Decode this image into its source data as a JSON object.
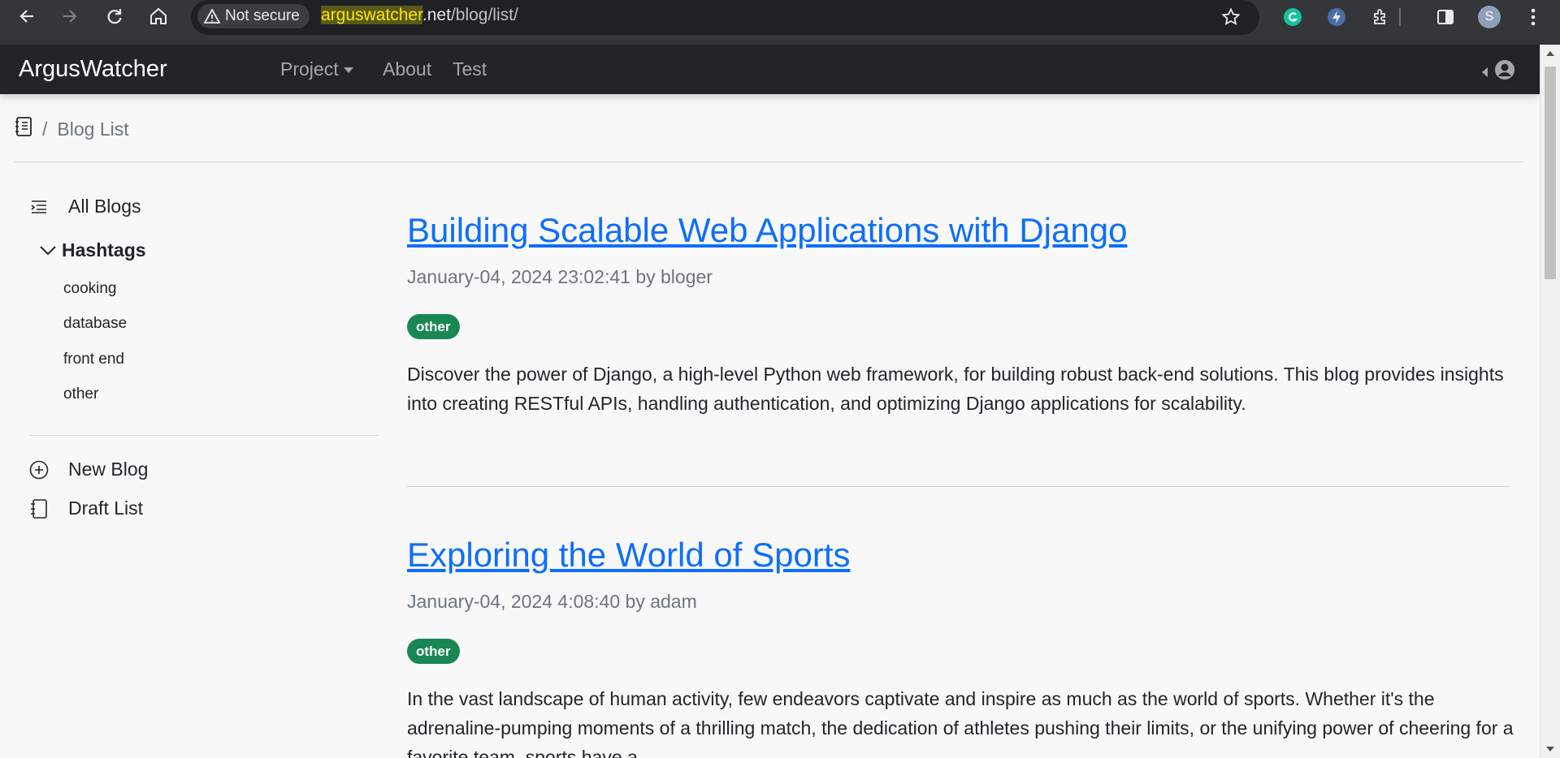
{
  "browser": {
    "security_label": "Not secure",
    "url_domain": "arguswatcher",
    "url_tld": ".net",
    "url_path": "/blog/list/",
    "profile_initial": "S",
    "icons": [
      "back-icon",
      "forward-icon",
      "reload-icon",
      "home-icon",
      "warning-icon",
      "star-icon",
      "grammarly-icon",
      "lightning-extension-icon",
      "extensions-icon",
      "side-panel-icon",
      "profile-avatar",
      "menu-icon"
    ]
  },
  "navbar": {
    "brand": "ArgusWatcher",
    "links": [
      "Project",
      "About",
      "Test"
    ]
  },
  "breadcrumb": {
    "separator": "/",
    "current": "Blog List"
  },
  "sidebar": {
    "all_blogs": "All Blogs",
    "hashtags_heading": "Hashtags",
    "hashtags": [
      "cooking",
      "database",
      "front end",
      "other"
    ],
    "new_blog": "New Blog",
    "draft_list": "Draft List"
  },
  "posts": [
    {
      "title": "Building Scalable Web Applications with Django",
      "meta": "January-04, 2024 23:02:41 by bloger",
      "tag": "other",
      "excerpt": "Discover the power of Django, a high-level Python web framework, for building robust back-end solutions. This blog provides insights into creating RESTful APIs, handling authentication, and optimizing Django applications for scalability."
    },
    {
      "title": "Exploring the World of Sports",
      "meta": "January-04, 2024 4:08:40 by adam",
      "tag": "other",
      "excerpt": "In the vast landscape of human activity, few endeavors captivate and inspire as much as the world of sports. Whether it's the adrenaline-pumping moments of a thrilling match, the dedication of athletes pushing their limits, or the unifying power of cheering for a favorite team, sports have a..."
    }
  ],
  "colors": {
    "navbar_bg": "#212529",
    "link": "#0d6efd",
    "badge": "#198754",
    "page_bg": "#f8f8f8"
  }
}
